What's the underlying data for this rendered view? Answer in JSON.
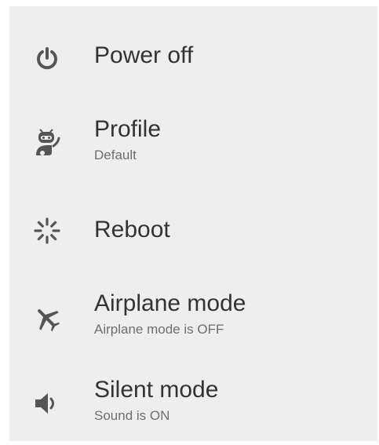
{
  "menu": {
    "items": [
      {
        "id": "power-off",
        "title": "Power off",
        "subtitle": null,
        "icon": "power-icon"
      },
      {
        "id": "profile",
        "title": "Profile",
        "subtitle": "Default",
        "icon": "cid-mascot-icon"
      },
      {
        "id": "reboot",
        "title": "Reboot",
        "subtitle": null,
        "icon": "reboot-spinner-icon"
      },
      {
        "id": "airplane-mode",
        "title": "Airplane mode",
        "subtitle": "Airplane mode is OFF",
        "icon": "airplane-icon"
      },
      {
        "id": "silent-mode",
        "title": "Silent mode",
        "subtitle": "Sound is ON",
        "icon": "speaker-icon"
      }
    ]
  },
  "colors": {
    "background": "#eeeeee",
    "title": "#333333",
    "subtitle": "#6e6e6e",
    "icon": "#555555"
  }
}
